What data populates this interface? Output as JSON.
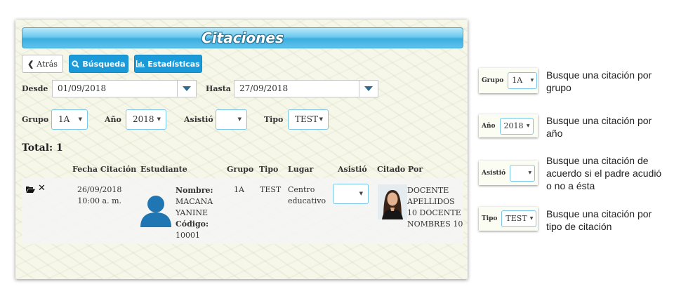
{
  "title": "Citaciones",
  "toolbar": {
    "back_label": "Atrás",
    "search_label": "Búsqueda",
    "stats_label": "Estadísticas"
  },
  "filters": {
    "desde_label": "Desde",
    "desde_value": "01/09/2018",
    "hasta_label": "Hasta",
    "hasta_value": "27/09/2018",
    "grupo_label": "Grupo",
    "grupo_value": "1A",
    "ano_label": "Año",
    "ano_value": "2018",
    "asistio_label": "Asistió",
    "asistio_value": "",
    "tipo_label": "Tipo",
    "tipo_value": "TEST"
  },
  "total_label": "Total: 1",
  "table": {
    "headers": [
      "Fecha Citación",
      "Estudiante",
      "Grupo",
      "Tipo",
      "Lugar",
      "Asistió",
      "Citado Por"
    ],
    "rows": [
      {
        "fecha_line1": "26/09/2018",
        "fecha_line2": "10:00 a. m.",
        "nombre_label": "Nombre:",
        "nombre_line1": "MACANA",
        "nombre_line2": "YANINE",
        "codigo_label": "Código:",
        "codigo": "10001",
        "grupo": "1A",
        "tipo": "TEST",
        "lugar_line1": "Centro",
        "lugar_line2": "educativo",
        "asistio": "",
        "citado_line1": "DOCENTE",
        "citado_line2": "APELLIDOS",
        "citado_line3": "10 DOCENTE",
        "citado_line4": "NOMBRES 10"
      }
    ]
  },
  "hints": [
    {
      "label": "Grupo",
      "value": "1A",
      "line1": "Busque una citación por",
      "line2": "grupo",
      "line3": ""
    },
    {
      "label": "Año",
      "value": "2018",
      "line1": "Busque una citación por",
      "line2": "año",
      "line3": ""
    },
    {
      "label": "Asistió",
      "value": "",
      "line1": "Busque una citación de",
      "line2": "acuerdo si el padre acudió",
      "line3": "o no a ésta"
    },
    {
      "label": "Tipo",
      "value": "TEST",
      "line1": "Busque una citación por",
      "line2": "tipo de citación",
      "line3": ""
    }
  ],
  "colors": {
    "accent": "#1a9ad9",
    "title_gradient_mid": "#3aaee0",
    "panel_bg": "#f6f7e8"
  }
}
